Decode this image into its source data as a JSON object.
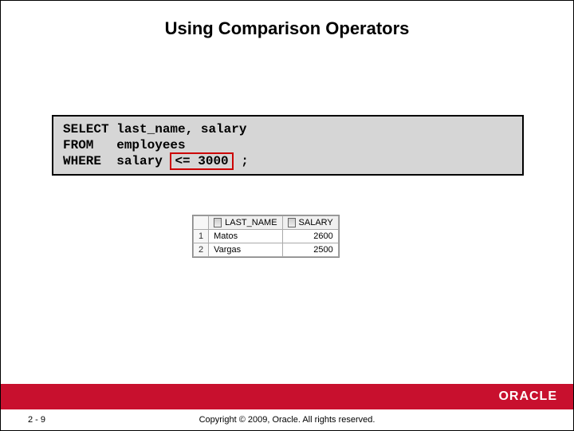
{
  "title": "Using Comparison Operators",
  "sql": {
    "kw_select": "SELECT",
    "sel_cols": "last_name, salary",
    "kw_from": "FROM",
    "from_tab": "employees",
    "kw_where": "WHERE",
    "where_col": "salary",
    "where_pred": "<= 3000",
    "terminator": ";"
  },
  "result": {
    "headers": {
      "c1": "LAST_NAME",
      "c2": "SALARY"
    },
    "rows": [
      {
        "n": "1",
        "last_name": "Matos",
        "salary": "2600"
      },
      {
        "n": "2",
        "last_name": "Vargas",
        "salary": "2500"
      }
    ]
  },
  "footer": {
    "page": "2 - 9",
    "copyright": "Copyright © 2009, Oracle. All rights reserved.",
    "logo": "ORACLE"
  }
}
